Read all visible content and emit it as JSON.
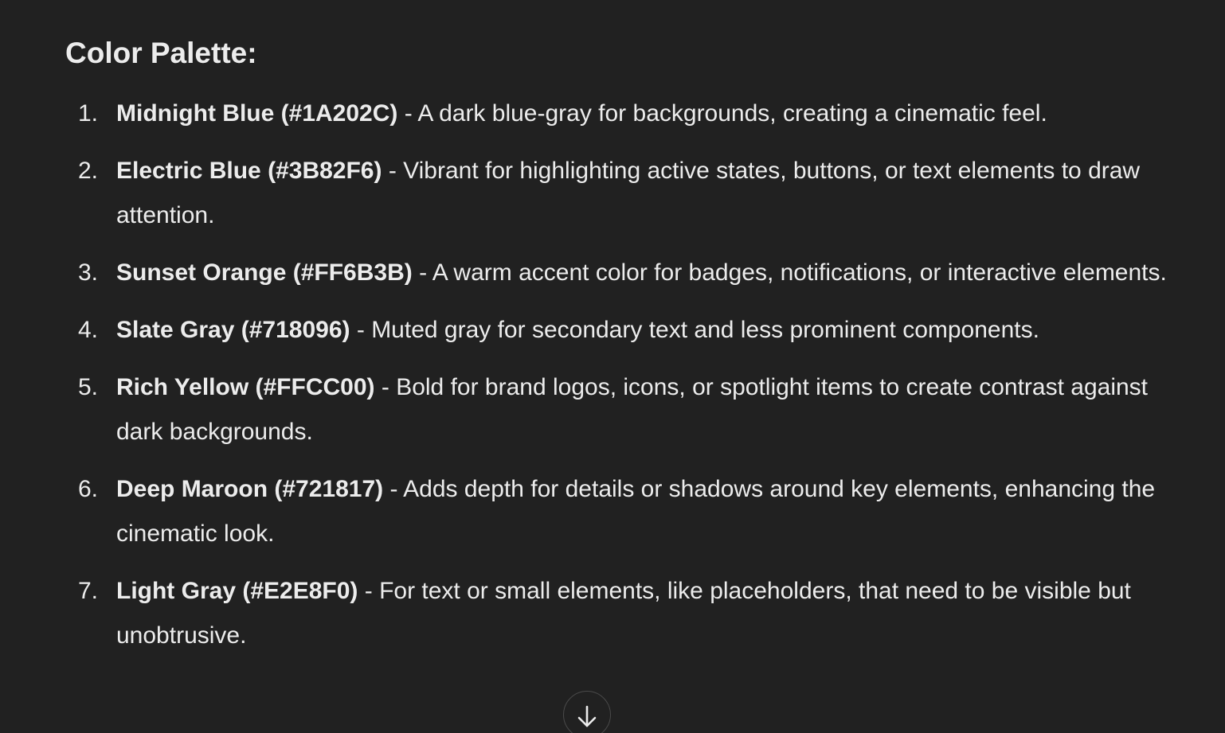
{
  "heading": "Color Palette:",
  "items": [
    {
      "number": "1.",
      "name": "Midnight Blue (#1A202C)",
      "desc": " - A dark blue-gray for backgrounds, creating a cinematic feel."
    },
    {
      "number": "2.",
      "name": "Electric Blue (#3B82F6)",
      "desc": " - Vibrant for highlighting active states, buttons, or text elements to draw attention."
    },
    {
      "number": "3.",
      "name": "Sunset Orange (#FF6B3B)",
      "desc": " - A warm accent color for badges, notifications, or interactive elements."
    },
    {
      "number": "4.",
      "name": "Slate Gray (#718096)",
      "desc": " - Muted gray for secondary text and less prominent components."
    },
    {
      "number": "5.",
      "name": "Rich Yellow (#FFCC00)",
      "desc": " - Bold for brand logos, icons, or spotlight items to create contrast against dark backgrounds."
    },
    {
      "number": "6.",
      "name": "Deep Maroon (#721817)",
      "desc": " - Adds depth for details or shadows around key elements, enhancing the cinematic look."
    },
    {
      "number": "7.",
      "name": "Light Gray (#E2E8F0)",
      "desc": " - For text or small elements, like placeholders, that need to be visible but unobtrusive."
    }
  ],
  "icons": {
    "scroll_down": "arrow-down-icon"
  },
  "colors": {
    "background": "#212121",
    "text": "#ececec"
  }
}
